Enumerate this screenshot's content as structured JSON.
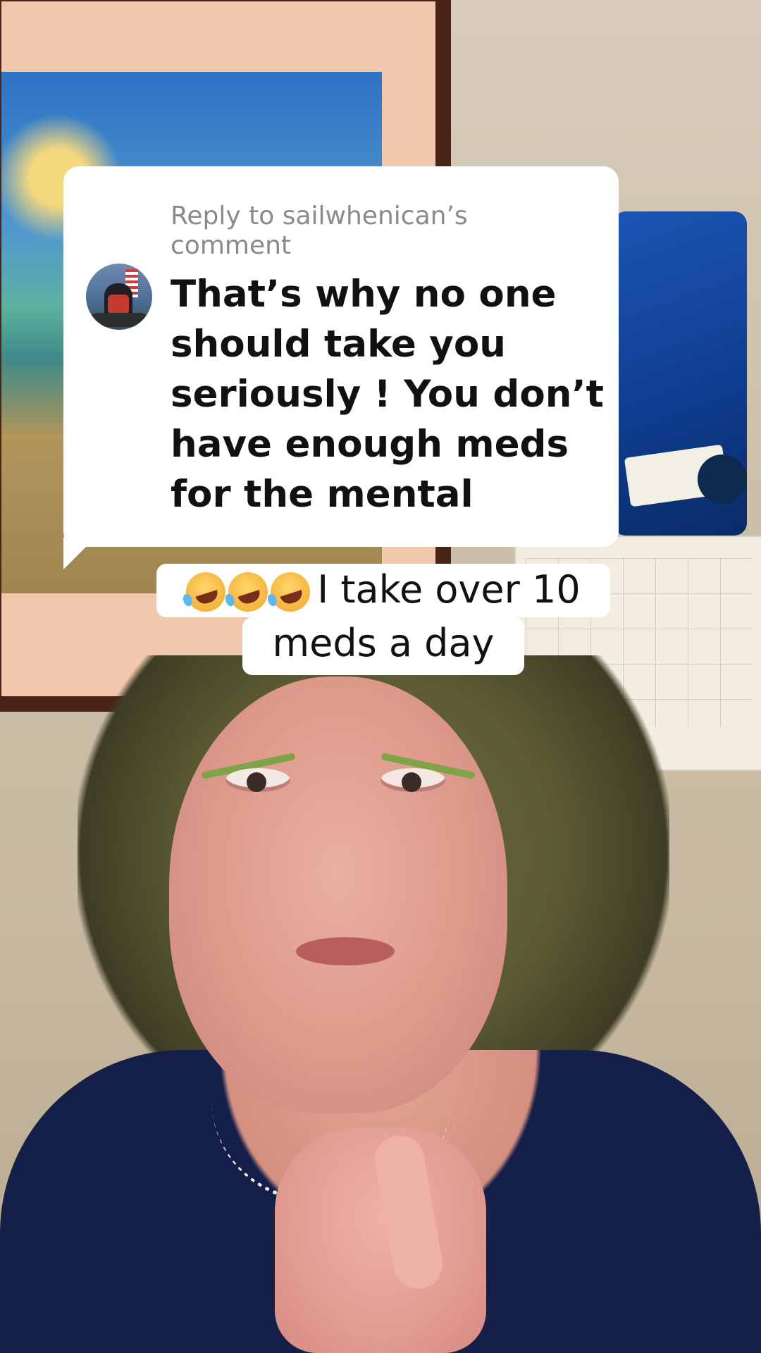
{
  "reply": {
    "header": "Reply to sailwhenican’s comment",
    "comment": "That’s why no one should take you seriously ! You don’t have enough meds for the mental"
  },
  "caption": {
    "line1_text": "I take over 10",
    "line2_text": "meds a day",
    "emoji_count": 3,
    "emoji_name": "rolling-on-the-floor-laughing-icon"
  },
  "colors": {
    "bubble_background": "#ffffff",
    "header_text": "#8a8a8a",
    "comment_text": "#111111",
    "caption_background": "#ffffff"
  }
}
